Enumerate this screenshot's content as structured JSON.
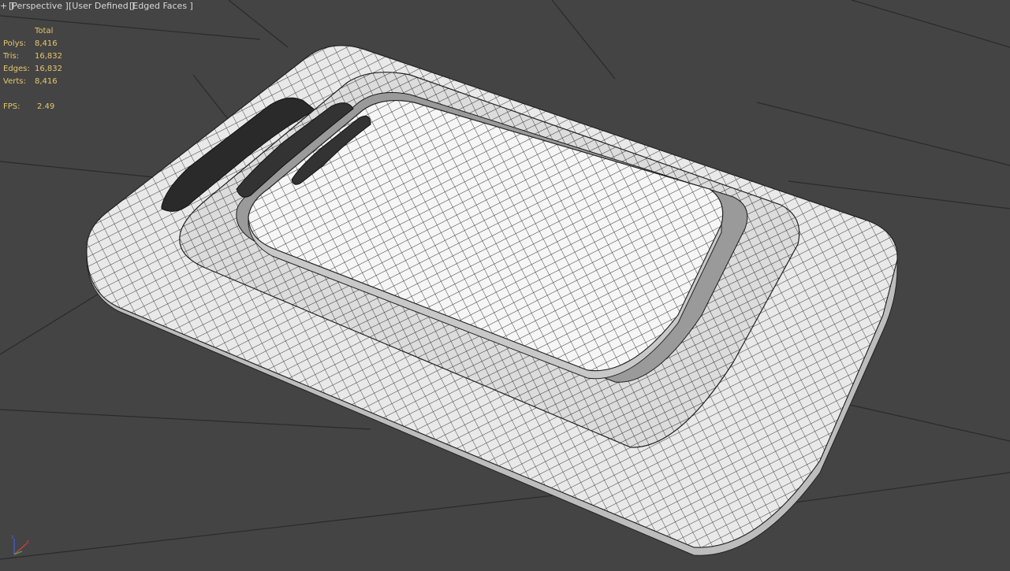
{
  "viewport": {
    "menu": {
      "plus": "+ ]",
      "view": "[Perspective ]",
      "shading": "[User Defined ]",
      "display": "[Edged Faces ]"
    },
    "stats": {
      "header": "Total",
      "rows": [
        {
          "label": "Polys:",
          "value": "8,416"
        },
        {
          "label": "Tris:",
          "value": "16,832"
        },
        {
          "label": "Edges:",
          "value": "16,832"
        },
        {
          "label": "Verts:",
          "value": "8,416"
        }
      ],
      "fps_label": "FPS:",
      "fps_value": "2.49"
    },
    "axis_gizmo": {
      "x_color": "#d04040",
      "y_color": "#40c040",
      "z_color": "#4060e0"
    }
  },
  "colors": {
    "background": "#444444",
    "grid": "#2a2a2a",
    "mesh_face": "#f2f2f2",
    "mesh_wire": "#1a1a1a",
    "stats_text": "#e6c66a",
    "menu_text": "#d8d8d8"
  }
}
